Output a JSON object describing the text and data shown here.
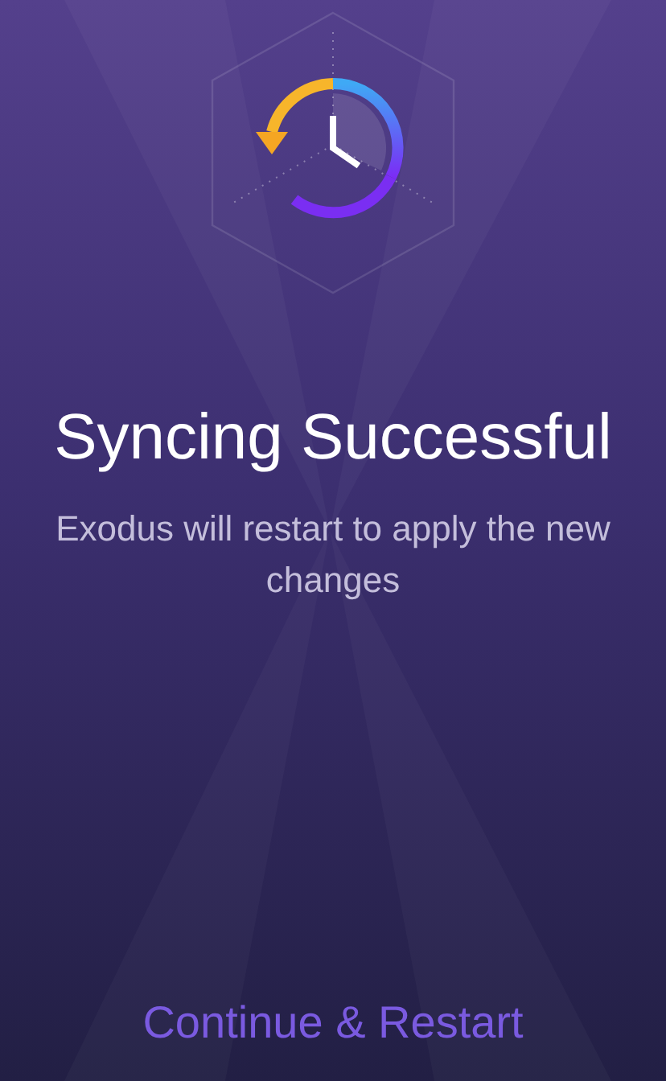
{
  "title": "Syncing Successful",
  "message": "Exodus will restart to apply the new changes",
  "action": {
    "label": "Continue & Restart"
  }
}
